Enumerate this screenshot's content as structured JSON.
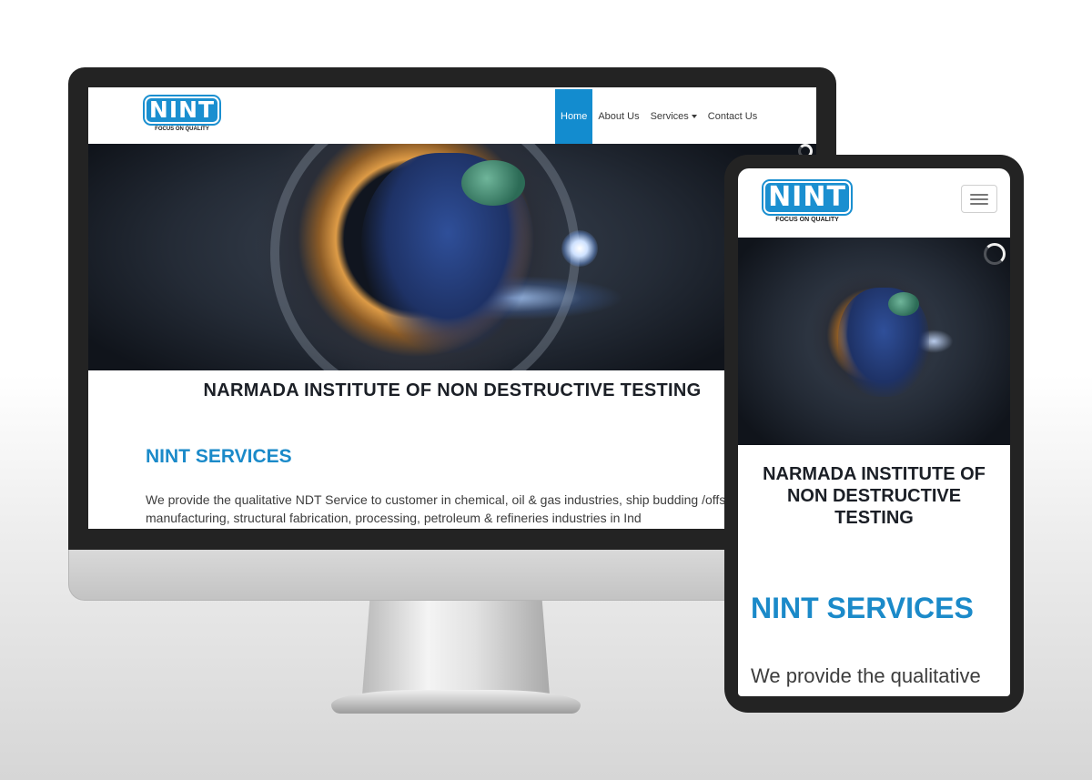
{
  "brand": {
    "logo_text": "NINT",
    "tagline": "FOCUS ON QUALITY"
  },
  "nav": {
    "items": [
      {
        "label": "Home",
        "active": true
      },
      {
        "label": "About Us",
        "active": false
      },
      {
        "label": "Services",
        "active": false,
        "has_dropdown": true
      },
      {
        "label": "Contact Us",
        "active": false
      }
    ]
  },
  "hero": {
    "image": "welder-inside-pipe-photo"
  },
  "content": {
    "institute_title": "NARMADA INSTITUTE OF NON DESTRUCTIVE TESTING",
    "services_heading": "NINT SERVICES",
    "services_text_desktop": "We provide the qualitative NDT Service to customer in chemical, oil & gas industries, ship budding /offshore manufacturing, structural fabrication, processing, petroleum & refineries industries in Ind",
    "services_text_mobile": "We provide the qualitative"
  },
  "colors": {
    "accent": "#138ccf",
    "heading_blue": "#1b8ac9",
    "device_frame": "#232323",
    "text_dark": "#1b1f26"
  },
  "icons": {
    "menu": "hamburger-menu-icon",
    "loader": "loading-spinner-icon",
    "dropdown": "caret-down-icon"
  }
}
